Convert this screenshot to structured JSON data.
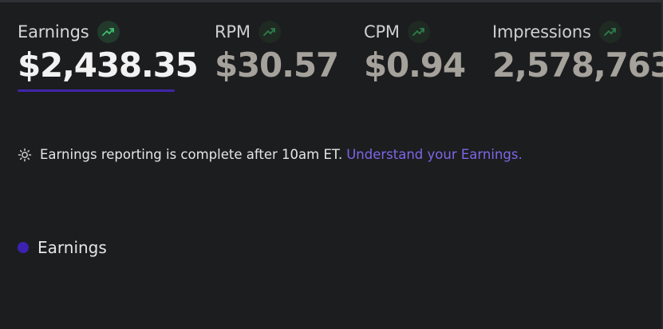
{
  "metrics": [
    {
      "label": "Earnings",
      "value": "$2,438.35",
      "trend": "up",
      "selected": true
    },
    {
      "label": "RPM",
      "value": "$30.57",
      "trend": "up",
      "selected": false
    },
    {
      "label": "CPM",
      "value": "$0.94",
      "trend": "up",
      "selected": false
    },
    {
      "label": "Impressions",
      "value": "2,578,763",
      "trend": "up",
      "selected": false
    }
  ],
  "notice": {
    "icon": "sun-icon",
    "text": "Earnings reporting is complete after 10am ET.",
    "link_text": "Understand your Earnings."
  },
  "legend": {
    "items": [
      {
        "label": "Earnings",
        "color": "#3b22b0"
      }
    ]
  },
  "colors": {
    "background": "#1c1d1f",
    "accent": "#3f25a8",
    "link": "#7f66e8",
    "trend_up": "#3fbf6f"
  }
}
